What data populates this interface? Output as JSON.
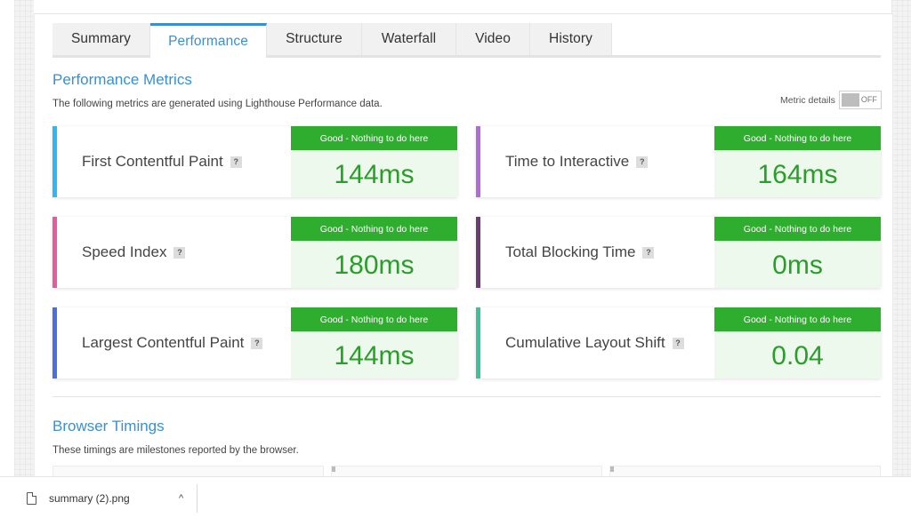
{
  "tabs": [
    {
      "label": "Summary",
      "active": false
    },
    {
      "label": "Performance",
      "active": true
    },
    {
      "label": "Structure",
      "active": false
    },
    {
      "label": "Waterfall",
      "active": false
    },
    {
      "label": "Video",
      "active": false
    },
    {
      "label": "History",
      "active": false
    }
  ],
  "performance": {
    "title": "Performance Metrics",
    "subtitle": "The following metrics are generated using Lighthouse Performance data.",
    "metric_details_label": "Metric details",
    "toggle_state": "OFF"
  },
  "metrics": [
    {
      "name": "First Contentful Paint",
      "badge": "Good - Nothing to do here",
      "value": "144ms",
      "color": "#2db7f5"
    },
    {
      "name": "Time to Interactive",
      "badge": "Good - Nothing to do here",
      "value": "164ms",
      "color": "#b06bd6"
    },
    {
      "name": "Speed Index",
      "badge": "Good - Nothing to do here",
      "value": "180ms",
      "color": "#e75a9b"
    },
    {
      "name": "Total Blocking Time",
      "badge": "Good - Nothing to do here",
      "value": "0ms",
      "color": "#6a3d72"
    },
    {
      "name": "Largest Contentful Paint",
      "badge": "Good - Nothing to do here",
      "value": "144ms",
      "color": "#4a6fe0"
    },
    {
      "name": "Cumulative Layout Shift",
      "badge": "Good - Nothing to do here",
      "value": "0.04",
      "color": "#3fbf9a"
    }
  ],
  "browser_timings": {
    "title": "Browser Timings",
    "subtitle": "These timings are milestones reported by the browser."
  },
  "download": {
    "filename": "summary (2).png",
    "chevron": "^"
  },
  "colors": {
    "accent": "#3a8fd2",
    "good_green": "#2fad2f",
    "good_bg": "#ecf9ec"
  }
}
